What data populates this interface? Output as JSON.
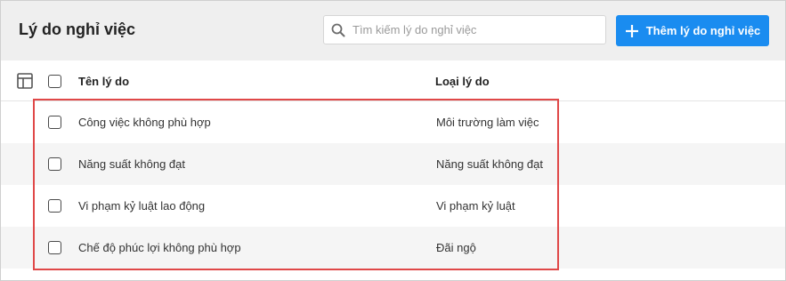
{
  "page": {
    "title": "Lý do nghỉ việc"
  },
  "search": {
    "placeholder": "Tìm kiếm lý do nghỉ việc",
    "icon": "search-icon"
  },
  "toolbar": {
    "add_label": "Thêm lý do nghỉ việc",
    "add_icon": "plus-icon",
    "accent": "#1a8cf0"
  },
  "table": {
    "columns": [
      "Tên lý do",
      "Loại lý do"
    ],
    "rows": [
      {
        "name": "Công việc không phù hợp",
        "type": "Môi trường làm việc"
      },
      {
        "name": "Năng suất không đạt",
        "type": "Năng suất không đạt"
      },
      {
        "name": "Vi phạm kỷ luật lao động",
        "type": "Vi phạm kỷ luật"
      },
      {
        "name": "Chế độ phúc lợi không phù hợp",
        "type": "Đãi ngộ"
      }
    ]
  },
  "highlight_color": "#e04848"
}
